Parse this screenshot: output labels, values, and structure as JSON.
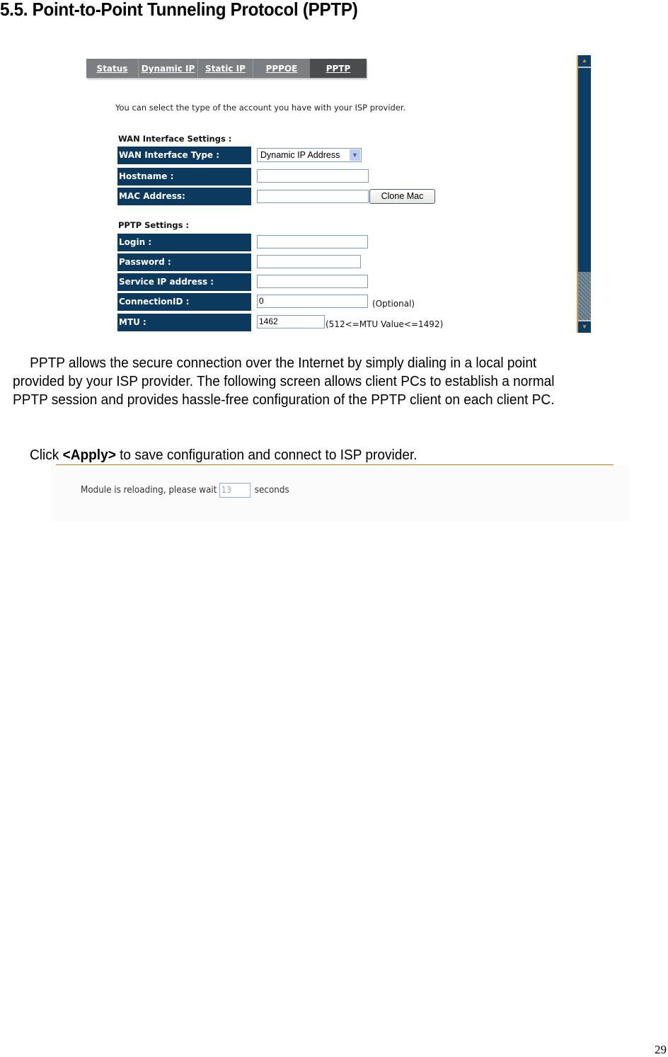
{
  "heading": "5.5. Point-to-Point Tunneling Protocol (PPTP)",
  "screenshot": {
    "tabs": [
      {
        "label": "Status",
        "active": false
      },
      {
        "label": "Dynamic IP",
        "active": false
      },
      {
        "label": "Static IP",
        "active": false
      },
      {
        "label": "PPPOE",
        "active": false
      },
      {
        "label": "PPTP",
        "active": true
      }
    ],
    "intro": "You can select the type of the account you have with your ISP provider.",
    "wan_section": {
      "title": "WAN Interface Settings :",
      "type_label": "WAN Interface Type :",
      "type_value": "Dynamic IP Address",
      "hostname_label": "Hostname :",
      "hostname_value": "",
      "mac_label": "MAC Address:",
      "mac_value": "",
      "clone_mac_button": "Clone Mac"
    },
    "pptp_section": {
      "title": "PPTP Settings :",
      "login_label": "Login :",
      "login_value": "",
      "password_label": "Password :",
      "password_value": "",
      "service_ip_label": "Service IP address :",
      "service_ip_value": "",
      "connection_id_label": "ConnectionID :",
      "connection_id_value": "0",
      "connection_id_note": "(Optional)",
      "mtu_label": "MTU :",
      "mtu_value": "1462",
      "mtu_note": "(512<=MTU Value<=1492)"
    },
    "scrollbar": {
      "up_icon": "▲",
      "down_icon": "▼"
    },
    "colors": {
      "label_bg": "#0b3a5e",
      "tab_bg": "#7b7f82",
      "tab_active_bg": "#4a4c4e",
      "scroll_accent": "#e49a45"
    }
  },
  "body": {
    "para1_line1": "PPTP allows the secure connection over the Internet by simply dialing in a local point",
    "para1_line2": "provided by your ISP provider. The following screen allows client PCs to establish a normal",
    "para1_line3": "PPTP session and provides hassle-free configuration of the PPTP client on each client PC.",
    "click_prefix": "Click ",
    "click_bold": "<Apply>",
    "click_suffix": " to save configuration and connect to ISP provider."
  },
  "reload": {
    "prefix": "Module is reloading, please wait",
    "countdown": "13",
    "suffix": "seconds"
  },
  "page_number": "29"
}
